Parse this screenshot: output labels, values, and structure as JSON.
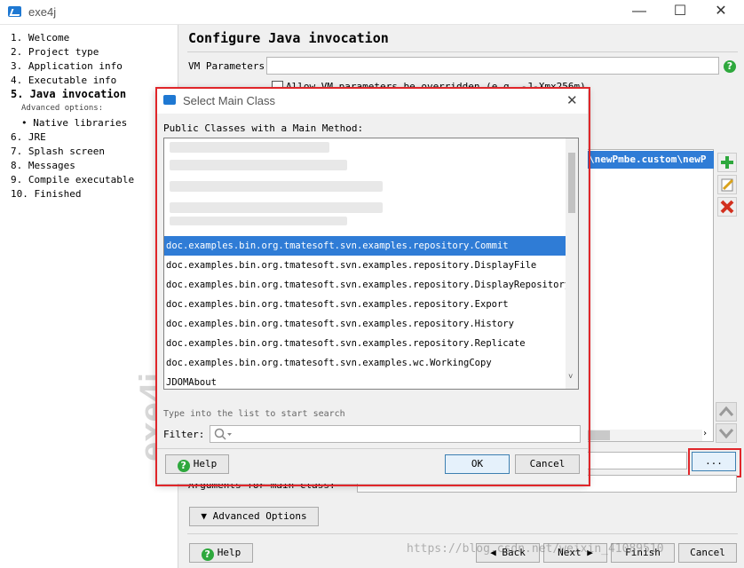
{
  "window": {
    "title": "exe4j",
    "minimize": "—",
    "maximize": "☐",
    "close": "✕"
  },
  "sidebar": {
    "steps": [
      "1. Welcome",
      "2. Project type",
      "3. Application info",
      "4. Executable info",
      "5. Java invocation",
      "Advanced options:",
      "• Native libraries",
      "6. JRE",
      "7. Splash screen",
      "8. Messages",
      "9. Compile executable",
      "10. Finished"
    ],
    "watermark": "exe4j"
  },
  "main": {
    "title": "Configure Java invocation",
    "vm_label": "VM Parameters:",
    "vm_value": "",
    "allow_text": "Allow VM parameters be overridden (e.g. -J-Xmx256m)",
    "classpath_entry": "\\newPmbe.custom\\newP",
    "args_label": "Arguments for main class:",
    "advanced_button": "Advanced Options",
    "browse_button": "...",
    "help_button": "Help",
    "back_button": "Back",
    "next_button": "Next",
    "finish_button": "Finish",
    "cancel_button": "Cancel",
    "url_watermark": "https://blog.csdn.net/weixin_41089510"
  },
  "dialog": {
    "title": "Select Main Class",
    "list_label": "Public Classes with a Main Method:",
    "items": [
      "doc.examples.bin.org.tmatesoft.svn.examples.repository.Commit",
      "doc.examples.bin.org.tmatesoft.svn.examples.repository.DisplayFile",
      "doc.examples.bin.org.tmatesoft.svn.examples.repository.DisplayRepositoryTre",
      "doc.examples.bin.org.tmatesoft.svn.examples.repository.Export",
      "doc.examples.bin.org.tmatesoft.svn.examples.repository.History",
      "doc.examples.bin.org.tmatesoft.svn.examples.repository.Replicate",
      "doc.examples.bin.org.tmatesoft.svn.examples.wc.WorkingCopy",
      "JDOMAbout"
    ],
    "hint": "Type into the list to start search",
    "filter_label": "Filter:",
    "filter_value": "",
    "help_button": "Help",
    "ok_button": "OK",
    "cancel_button": "Cancel"
  },
  "colors": {
    "selection": "#2f7cd6",
    "highlight_border": "#e0262a",
    "help_green": "#2ea83d"
  }
}
